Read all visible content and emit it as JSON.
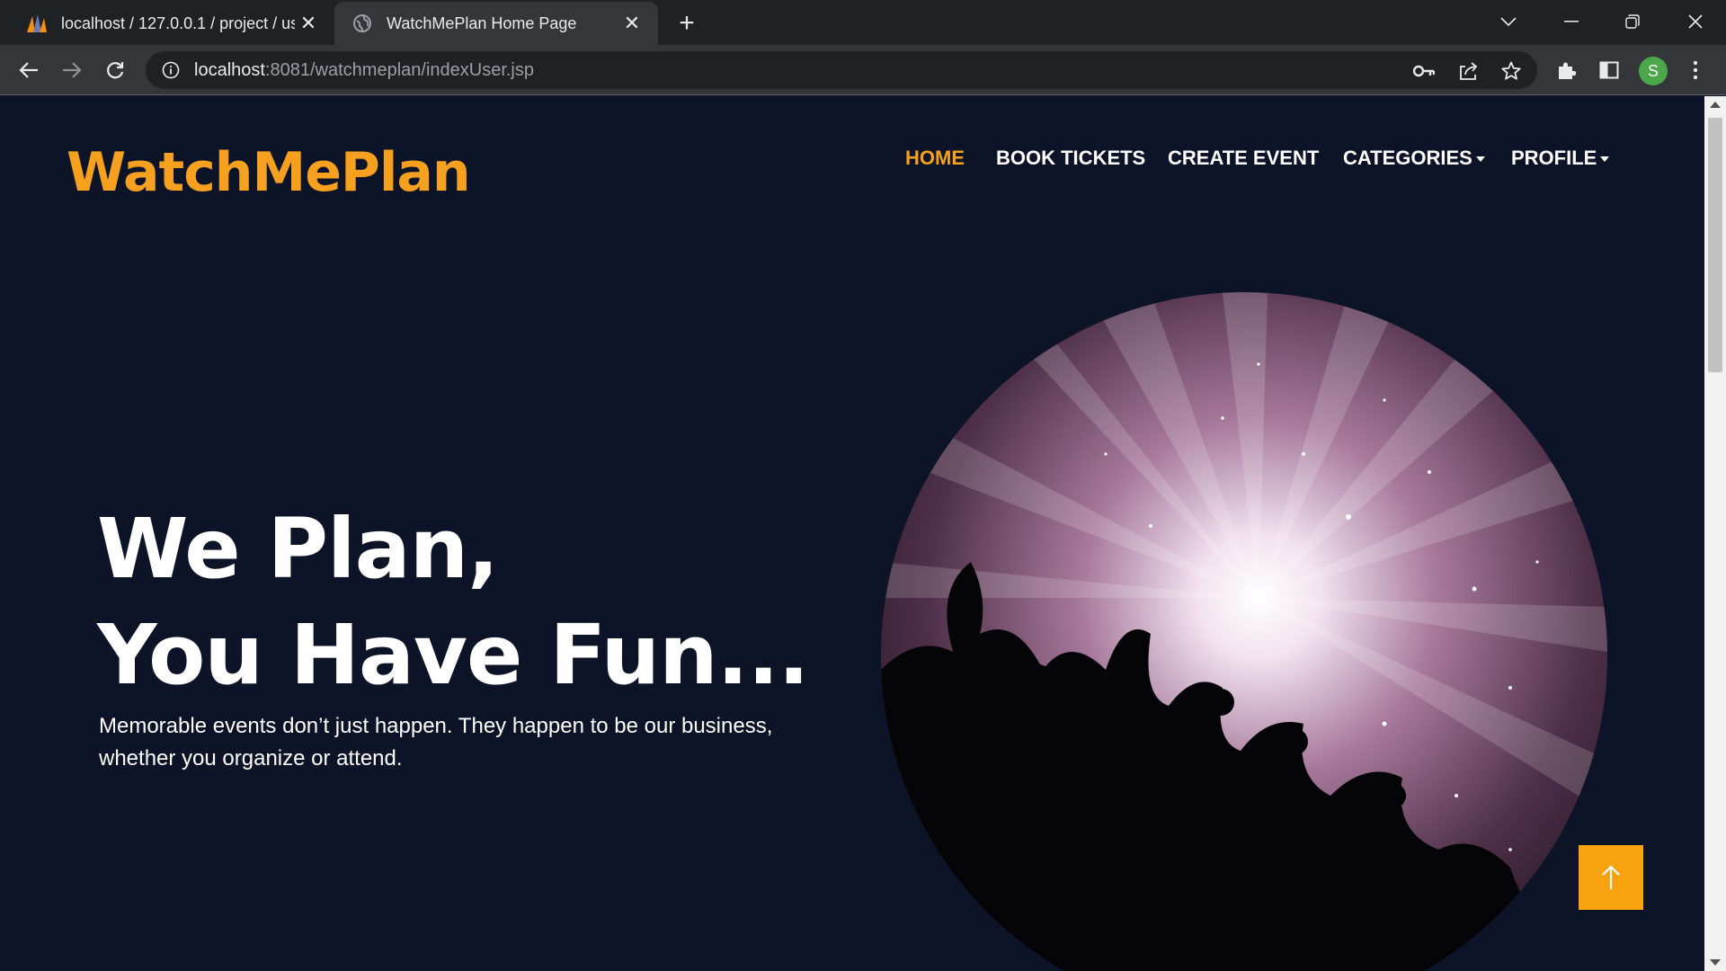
{
  "browser": {
    "tabs": [
      {
        "title": "localhost / 127.0.0.1 / project / us",
        "icon": "phpmyadmin-icon",
        "active": false
      },
      {
        "title": "WatchMePlan Home Page",
        "icon": "globe-icon",
        "active": true
      }
    ],
    "url_host": "localhost",
    "url_rest": ":8081/watchmeplan/indexUser.jsp",
    "profile_initial": "S"
  },
  "site": {
    "brand": "WatchMePlan",
    "brand_color": "#f5a11f",
    "nav": [
      {
        "label": "HOME",
        "active": true
      },
      {
        "label": "BOOK TICKETS",
        "active": false
      },
      {
        "label": "CREATE EVENT",
        "active": false
      },
      {
        "label": "CATEGORIES",
        "active": false,
        "dropdown": true
      },
      {
        "label": "PROFILE",
        "active": false,
        "dropdown": true
      }
    ]
  },
  "hero": {
    "title_line1": "We Plan,",
    "title_line2": "You Have Fun...",
    "subtitle": "Memorable events don’t just happen. They happen to be our business, whether you organize or attend."
  },
  "colors": {
    "page_bg": "#0d1428",
    "accent": "#f8a20f"
  }
}
